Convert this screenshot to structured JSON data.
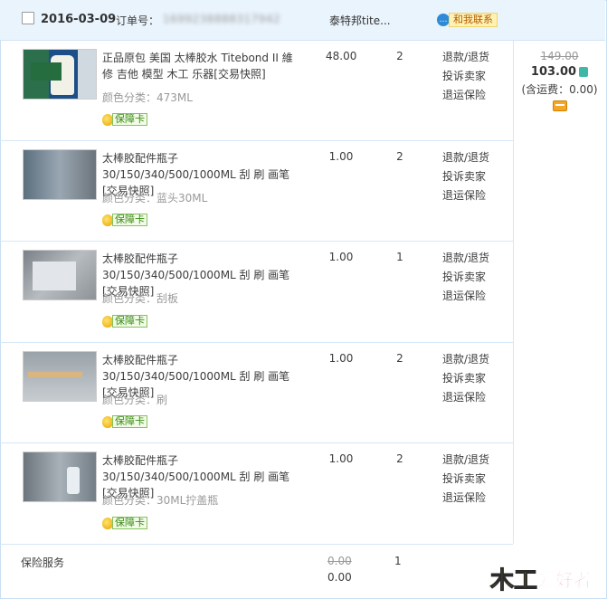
{
  "order": {
    "date": "2016-03-09",
    "order_label": "订单号：",
    "order_number": "1699238888317942",
    "shop": "泰特邦tite...",
    "contact_label": "和我联系"
  },
  "items": [
    {
      "title": "正品原包 美国 太棒胶水 Titebond II 維修 吉他 模型 木工 乐器[交易快照]",
      "sku": "颜色分类：473ML",
      "badge": "保障卡",
      "price": "48.00",
      "qty": "2",
      "actions": [
        "退款/退货",
        "投诉卖家",
        "退运保险"
      ]
    },
    {
      "title": "太棒胶配件瓶子30/150/340/500/1000ML 刮 刷 画笔[交易快照]",
      "sku": "颜色分类：蓝头30ML",
      "badge": "保障卡",
      "price": "1.00",
      "qty": "2",
      "actions": [
        "退款/退货",
        "投诉卖家",
        "退运保险"
      ]
    },
    {
      "title": "太棒胶配件瓶子30/150/340/500/1000ML 刮 刷 画笔[交易快照]",
      "sku": "颜色分类：刮板",
      "badge": "保障卡",
      "price": "1.00",
      "qty": "1",
      "actions": [
        "退款/退货",
        "投诉卖家",
        "退运保险"
      ]
    },
    {
      "title": "太棒胶配件瓶子30/150/340/500/1000ML 刮 刷 画笔[交易快照]",
      "sku": "颜色分类：刷",
      "badge": "保障卡",
      "price": "1.00",
      "qty": "2",
      "actions": [
        "退款/退货",
        "投诉卖家",
        "退运保险"
      ]
    },
    {
      "title": "太棒胶配件瓶子30/150/340/500/1000ML 刮 刷 画笔[交易快照]",
      "sku": "颜色分类：30ML拧盖瓶",
      "badge": "保障卡",
      "price": "1.00",
      "qty": "2",
      "actions": [
        "退款/退货",
        "投诉卖家",
        "退运保险"
      ]
    }
  ],
  "summary": {
    "original_price": "149.00",
    "total": "103.00",
    "shipping": "(含运费：0.00)"
  },
  "insurance": {
    "label": "保险服务",
    "original_price": "0.00",
    "price": "0.00",
    "qty": "1"
  },
  "watermark": "木工爱好者"
}
